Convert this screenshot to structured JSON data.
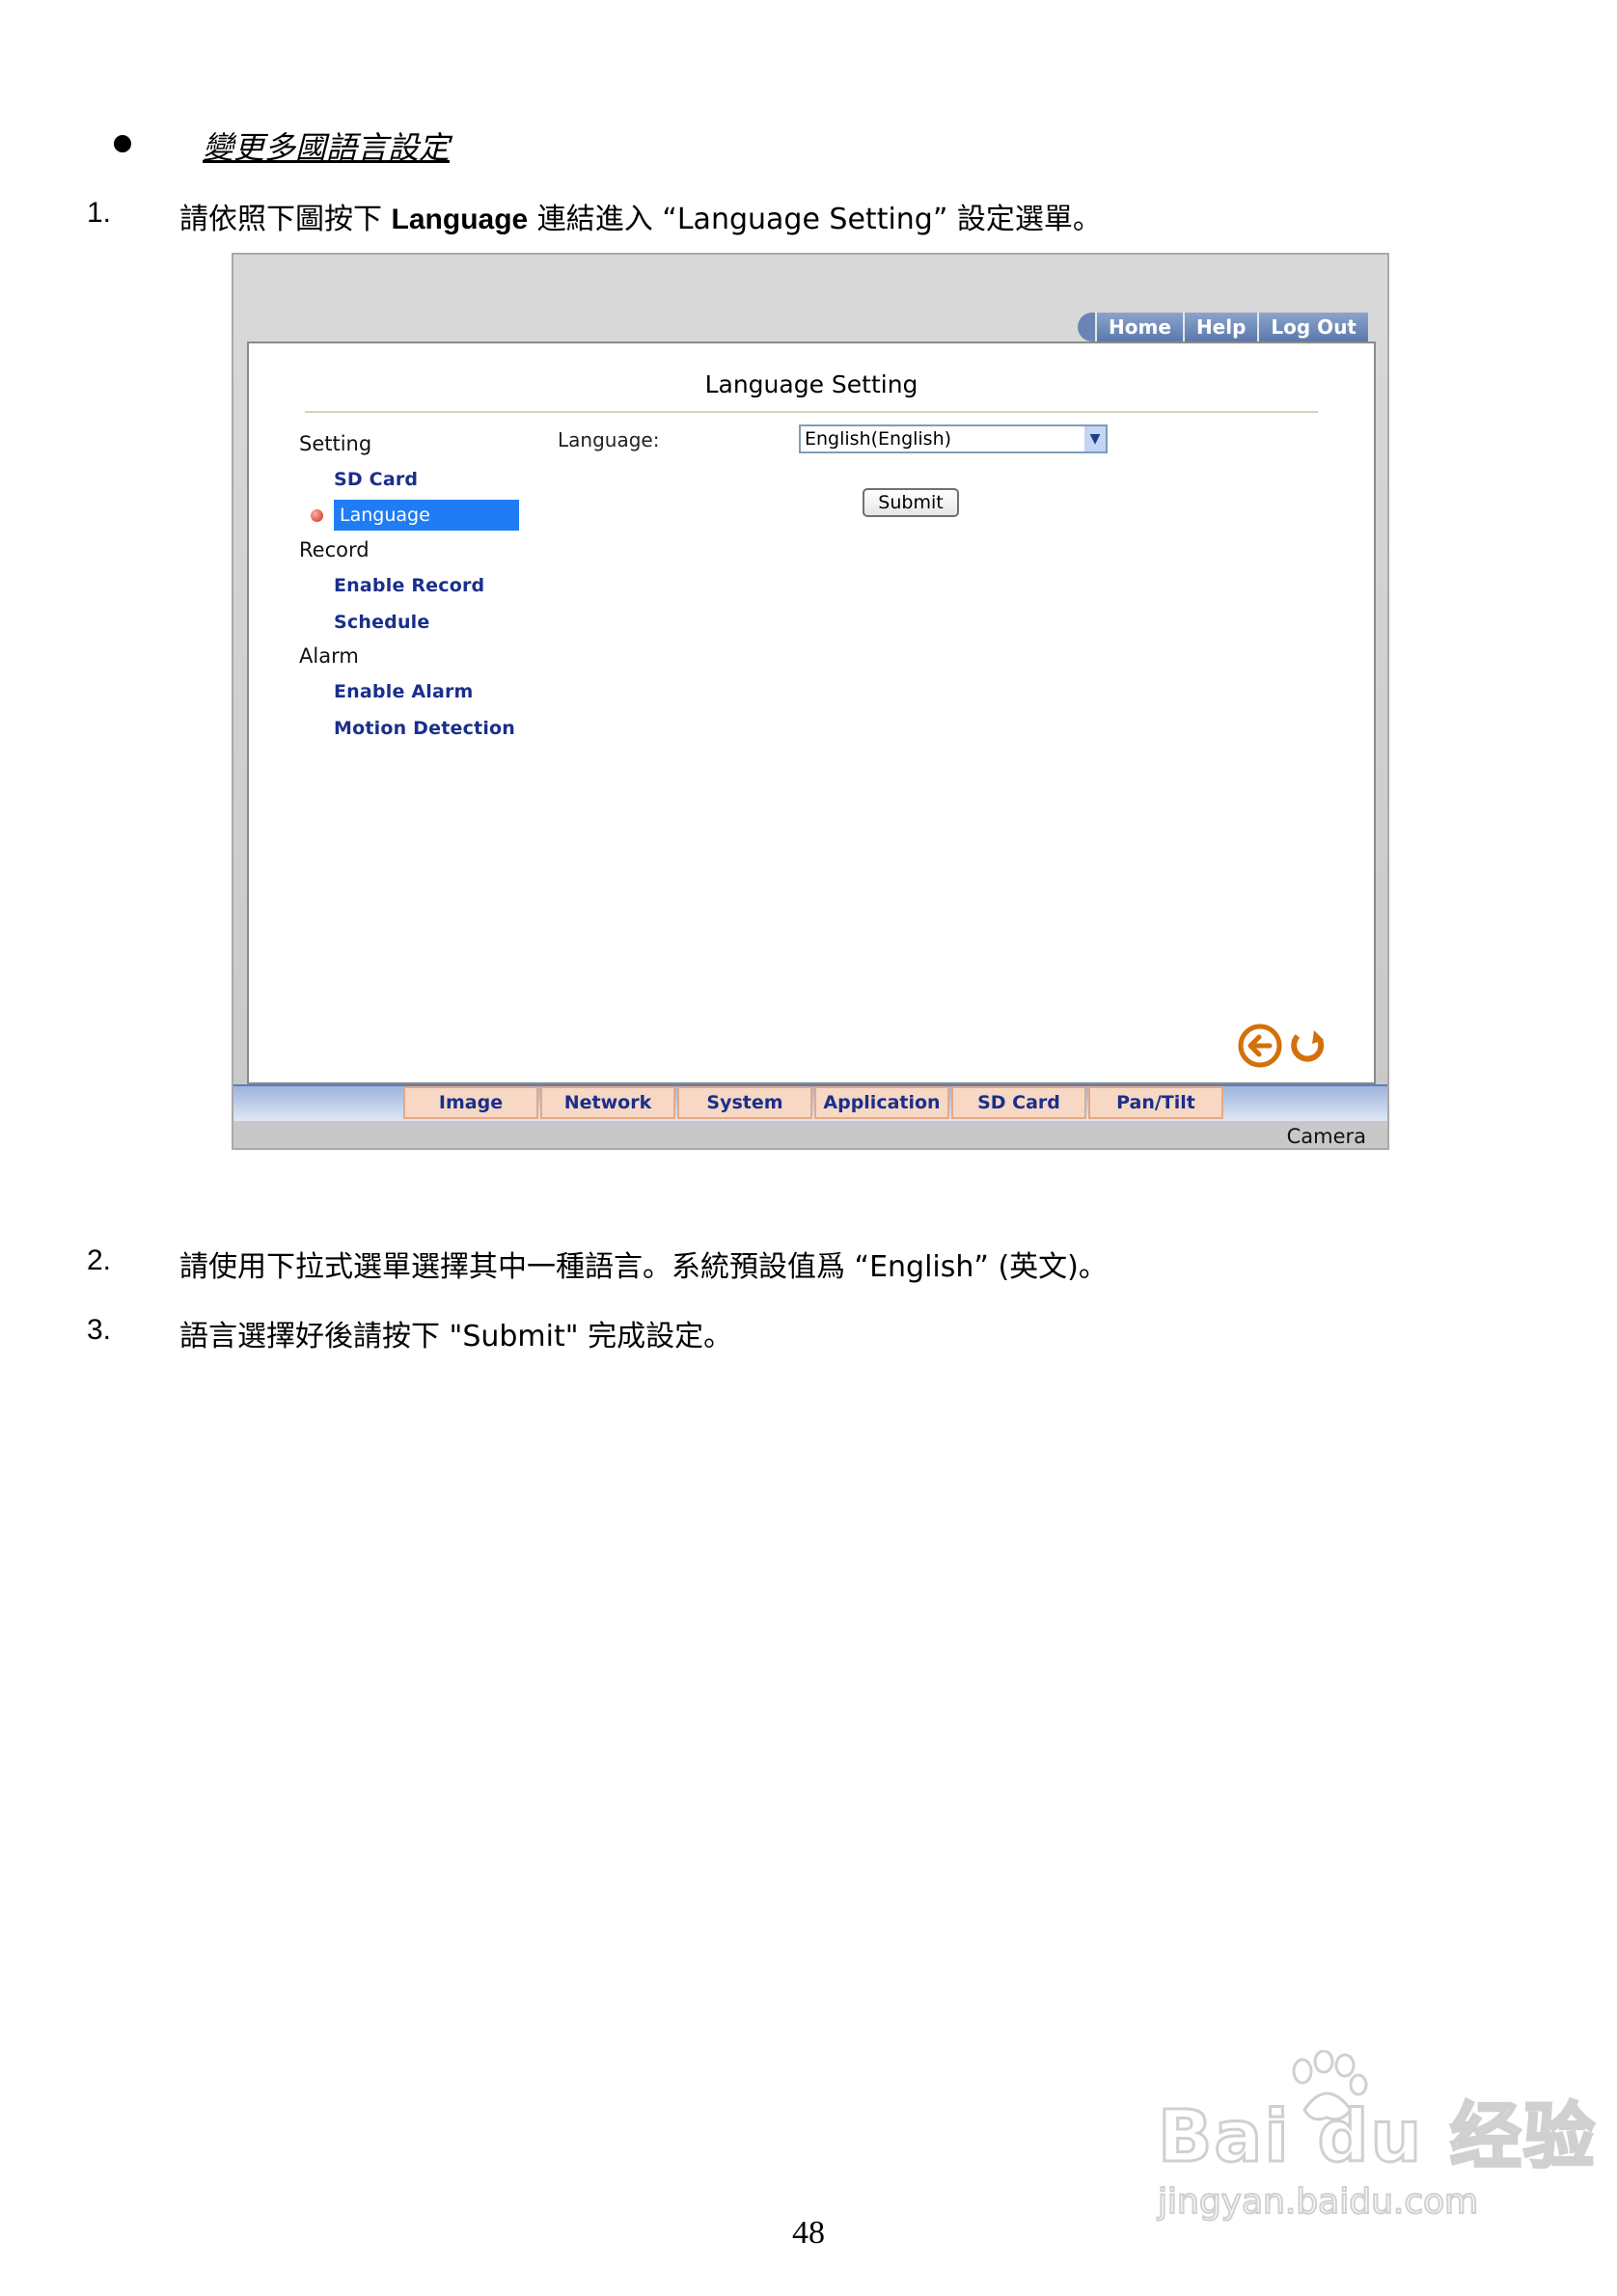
{
  "heading": "變更多國語言設定",
  "steps": [
    {
      "num": "1.",
      "pre": "請依照下圖按下 ",
      "bold": "Language",
      "post": " 連結進入 “Language Setting” 設定選單。"
    },
    {
      "num": "2.",
      "text": "請使用下拉式選單選擇其中一種語言。系統預設值爲 “English” (英文)。"
    },
    {
      "num": "3.",
      "text": "語言選擇好後請按下 \"Submit\" 完成設定。"
    }
  ],
  "screenshot": {
    "topnav": [
      "Home",
      "Help",
      "Log Out"
    ],
    "title": "Language Setting",
    "menu": {
      "setting_head": "Setting",
      "sd_card": "SD Card",
      "language": "Language",
      "record_head": "Record",
      "enable_record": "Enable Record",
      "schedule": "Schedule",
      "alarm_head": "Alarm",
      "enable_alarm": "Enable Alarm",
      "motion_detection": "Motion Detection"
    },
    "form": {
      "language_label": "Language:",
      "language_value": "English(English)",
      "submit_label": "Submit"
    },
    "tabs": [
      "Image",
      "Network",
      "System",
      "Application",
      "SD Card",
      "Pan/Tilt"
    ],
    "footer": "Camera",
    "icons": [
      "back-arrow-icon",
      "refresh-icon"
    ]
  },
  "page_number": "48",
  "watermark": {
    "brand": "Bai du 经验",
    "url": "jingyan.baidu.com"
  }
}
